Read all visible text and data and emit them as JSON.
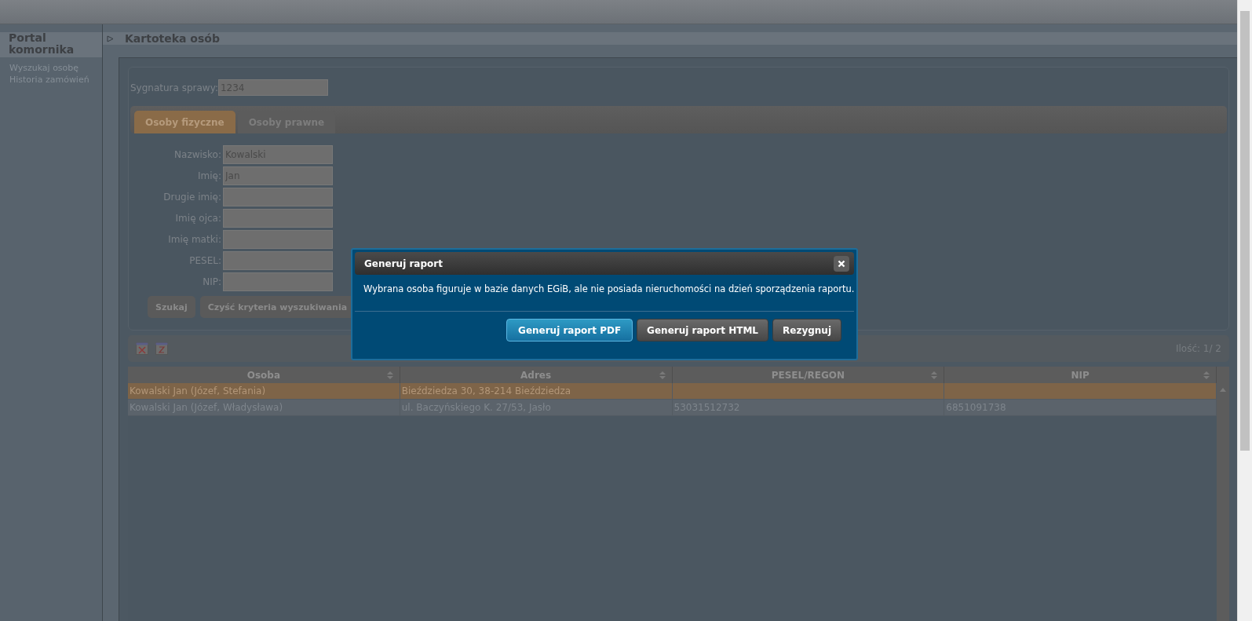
{
  "sidebar": {
    "title": "Portal komornika",
    "items": [
      "Wyszukaj osobę",
      "Historia zamówień"
    ]
  },
  "page": {
    "title": "Kartoteka osób"
  },
  "case_field": {
    "label": "Sygnatura sprawy:",
    "value": "1234"
  },
  "tabs": [
    {
      "label": "Osoby fizyczne",
      "selected": true
    },
    {
      "label": "Osoby prawne",
      "selected": false
    }
  ],
  "form_fields": [
    {
      "label": "Nazwisko:",
      "value": "Kowalski"
    },
    {
      "label": "Imię:",
      "value": "Jan"
    },
    {
      "label": "Drugie imię:"
    },
    {
      "label": "Imię ojca:"
    },
    {
      "label": "Imię matki:"
    },
    {
      "label": "PESEL:"
    },
    {
      "label": "NIP:"
    }
  ],
  "form_buttons": [
    "Szukaj",
    "Czyść kryteria wyszukiwania"
  ],
  "results_toolbar": {
    "count": "Ilość: 1/ 2"
  },
  "table": {
    "columns": [
      "Osoba",
      "Adres",
      "PESEL/REGON",
      "NIP"
    ],
    "rows": [
      {
        "selected": true,
        "cells": [
          "Kowalski Jan (Józef, Stefania)",
          "Bieździedza 30, 38-214 Bieździedza",
          "",
          ""
        ]
      },
      {
        "selected": false,
        "cells": [
          "Kowalski Jan (Józef, Władysława)",
          "ul. Baczyńskiego K. 27/53, Jasło",
          "53031512732",
          "6851091738"
        ]
      }
    ]
  },
  "dialog": {
    "title": "Generuj raport",
    "message": "Wybrana osoba figuruje w bazie danych EGiB, ale nie posiada nieruchomości na dzień sporządzenia raportu.",
    "buttons": [
      {
        "label": "Generuj raport PDF",
        "selected": true
      },
      {
        "label": "Generuj raport HTML",
        "selected": false
      },
      {
        "label": "Rezygnuj",
        "selected": false
      }
    ]
  }
}
